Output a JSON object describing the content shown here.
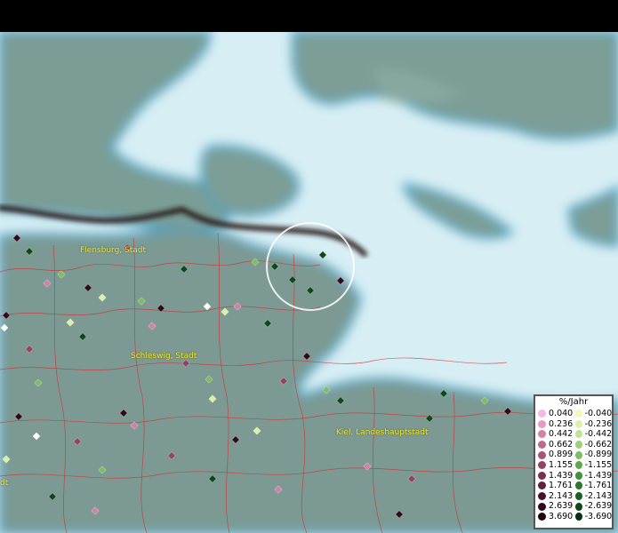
{
  "map": {
    "places": [
      "Flensburg, Stadt",
      "Schleswig, Stadt",
      "Kiel, Landeshauptstadt",
      "dt"
    ],
    "colors": {
      "sea": "#d7eef4",
      "land": "#7d9f98",
      "coast": "#3ea3c9",
      "border": "#d22a2a",
      "national_border": "#2a1c1c",
      "marker_ring": "#ffffff"
    }
  },
  "legend": {
    "title": "%/Jahr",
    "positive": [
      {
        "label": "0.040",
        "color": "#f7b8e6"
      },
      {
        "label": "0.236",
        "color": "#e89ac6"
      },
      {
        "label": "0.442",
        "color": "#d67fa8"
      },
      {
        "label": "0.662",
        "color": "#c06890"
      },
      {
        "label": "0.899",
        "color": "#a85478"
      },
      {
        "label": "1.155",
        "color": "#944262"
      },
      {
        "label": "1.439",
        "color": "#7c3050"
      },
      {
        "label": "1.761",
        "color": "#63203c"
      },
      {
        "label": "2.143",
        "color": "#4a122a"
      },
      {
        "label": "2.639",
        "color": "#33081a"
      },
      {
        "label": "3.690",
        "color": "#1e0210"
      }
    ],
    "negative": [
      {
        "label": "-0.040",
        "color": "#f3f7b8"
      },
      {
        "label": "-0.236",
        "color": "#dcf0a8"
      },
      {
        "label": "-0.442",
        "color": "#bfe294"
      },
      {
        "label": "-0.662",
        "color": "#9fd07c"
      },
      {
        "label": "-0.899",
        "color": "#7fbc64"
      },
      {
        "label": "-1.155",
        "color": "#5ea84e"
      },
      {
        "label": "-1.439",
        "color": "#41903c"
      },
      {
        "label": "-1.761",
        "color": "#2a782e"
      },
      {
        "label": "-2.143",
        "color": "#186024"
      },
      {
        "label": "-2.639",
        "color": "#0c481a"
      },
      {
        "label": "-3.690",
        "color": "#033010"
      }
    ]
  }
}
